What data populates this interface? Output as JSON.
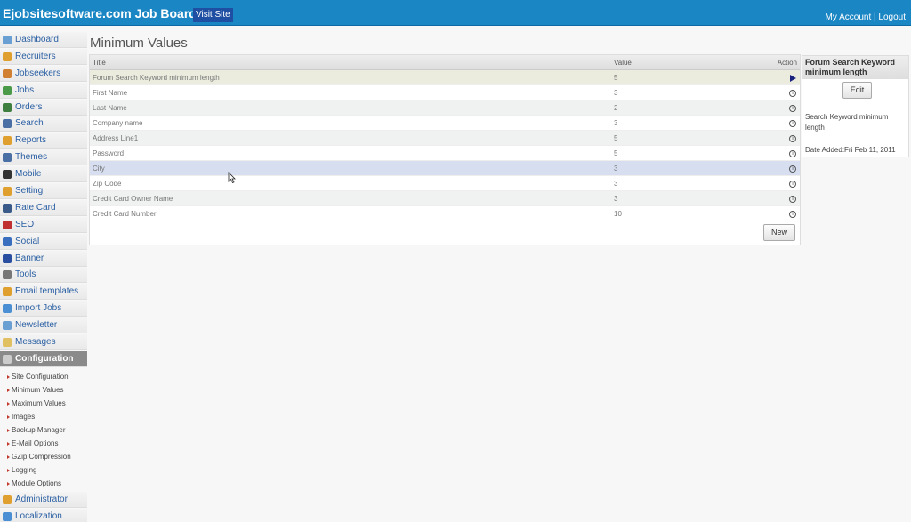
{
  "header": {
    "brand": "Ejobsitesoftware.com Job Board",
    "visit_site": "Visit Site",
    "my_account": "My Account",
    "separator": "|",
    "logout": "Logout"
  },
  "sidebar": {
    "items": [
      {
        "label": "Dashboard",
        "icon": "home-icon",
        "color": "#6a9fd4"
      },
      {
        "label": "Recruiters",
        "icon": "recruiter-icon",
        "color": "#e0a030"
      },
      {
        "label": "Jobseekers",
        "icon": "jobseekers-icon",
        "color": "#d08030"
      },
      {
        "label": "Jobs",
        "icon": "jobs-icon",
        "color": "#4a9a4a"
      },
      {
        "label": "Orders",
        "icon": "orders-icon",
        "color": "#3f7f3f"
      },
      {
        "label": "Search",
        "icon": "search-icon",
        "color": "#4a6fa5"
      },
      {
        "label": "Reports",
        "icon": "reports-icon",
        "color": "#e0a030"
      },
      {
        "label": "Themes",
        "icon": "themes-icon",
        "color": "#4a6fa5"
      },
      {
        "label": "Mobile",
        "icon": "mobile-icon",
        "color": "#333333"
      },
      {
        "label": "Setting",
        "icon": "gear-icon",
        "color": "#e0a030"
      },
      {
        "label": "Rate Card",
        "icon": "dollar-icon",
        "color": "#3a5a8a"
      },
      {
        "label": "SEO",
        "icon": "seo-icon",
        "color": "#c03030"
      },
      {
        "label": "Social",
        "icon": "social-icon",
        "color": "#3a6fc0"
      },
      {
        "label": "Banner",
        "icon": "banner-icon",
        "color": "#2a4fa0"
      },
      {
        "label": "Tools",
        "icon": "tools-icon",
        "color": "#777777"
      },
      {
        "label": "Email templates",
        "icon": "email-icon",
        "color": "#e0a030"
      },
      {
        "label": "Import Jobs",
        "icon": "import-icon",
        "color": "#4a8fd4"
      },
      {
        "label": "Newsletter",
        "icon": "newsletter-icon",
        "color": "#6a9fd4"
      },
      {
        "label": "Messages",
        "icon": "messages-icon",
        "color": "#e0c060"
      },
      {
        "label": "Configuration",
        "icon": "configuration-icon",
        "color": "#cccccc"
      }
    ],
    "config_sub": [
      "Site Configuration",
      "Minimum Values",
      "Maximum Values",
      "Images",
      "Backup Manager",
      "E-Mail Options",
      "GZip Compression",
      "Logging",
      "Module Options"
    ],
    "bottom_items": [
      {
        "label": "Administrator",
        "icon": "lock-icon",
        "color": "#e0a030"
      },
      {
        "label": "Localization",
        "icon": "globe-icon",
        "color": "#4a8fd4"
      }
    ]
  },
  "main": {
    "title": "Minimum Values",
    "columns": {
      "title": "Title",
      "value": "Value",
      "action": "Action"
    },
    "rows": [
      {
        "title": "Forum Search Keyword minimum length",
        "value": "5"
      },
      {
        "title": "First Name",
        "value": "3"
      },
      {
        "title": "Last Name",
        "value": "2"
      },
      {
        "title": "Company name",
        "value": "3"
      },
      {
        "title": "Address Line1",
        "value": "5"
      },
      {
        "title": "Password",
        "value": "5"
      },
      {
        "title": "City",
        "value": "3"
      },
      {
        "title": "Zip Code",
        "value": "3"
      },
      {
        "title": "Credit Card Owner Name",
        "value": "3"
      },
      {
        "title": "Credit Card Number",
        "value": "10"
      }
    ],
    "new_label": "New"
  },
  "detail": {
    "heading": "Forum Search Keyword minimum length",
    "edit_label": "Edit",
    "description": "Search Keyword minimum length",
    "date_added": "Date Added:Fri Feb 11, 2011"
  }
}
